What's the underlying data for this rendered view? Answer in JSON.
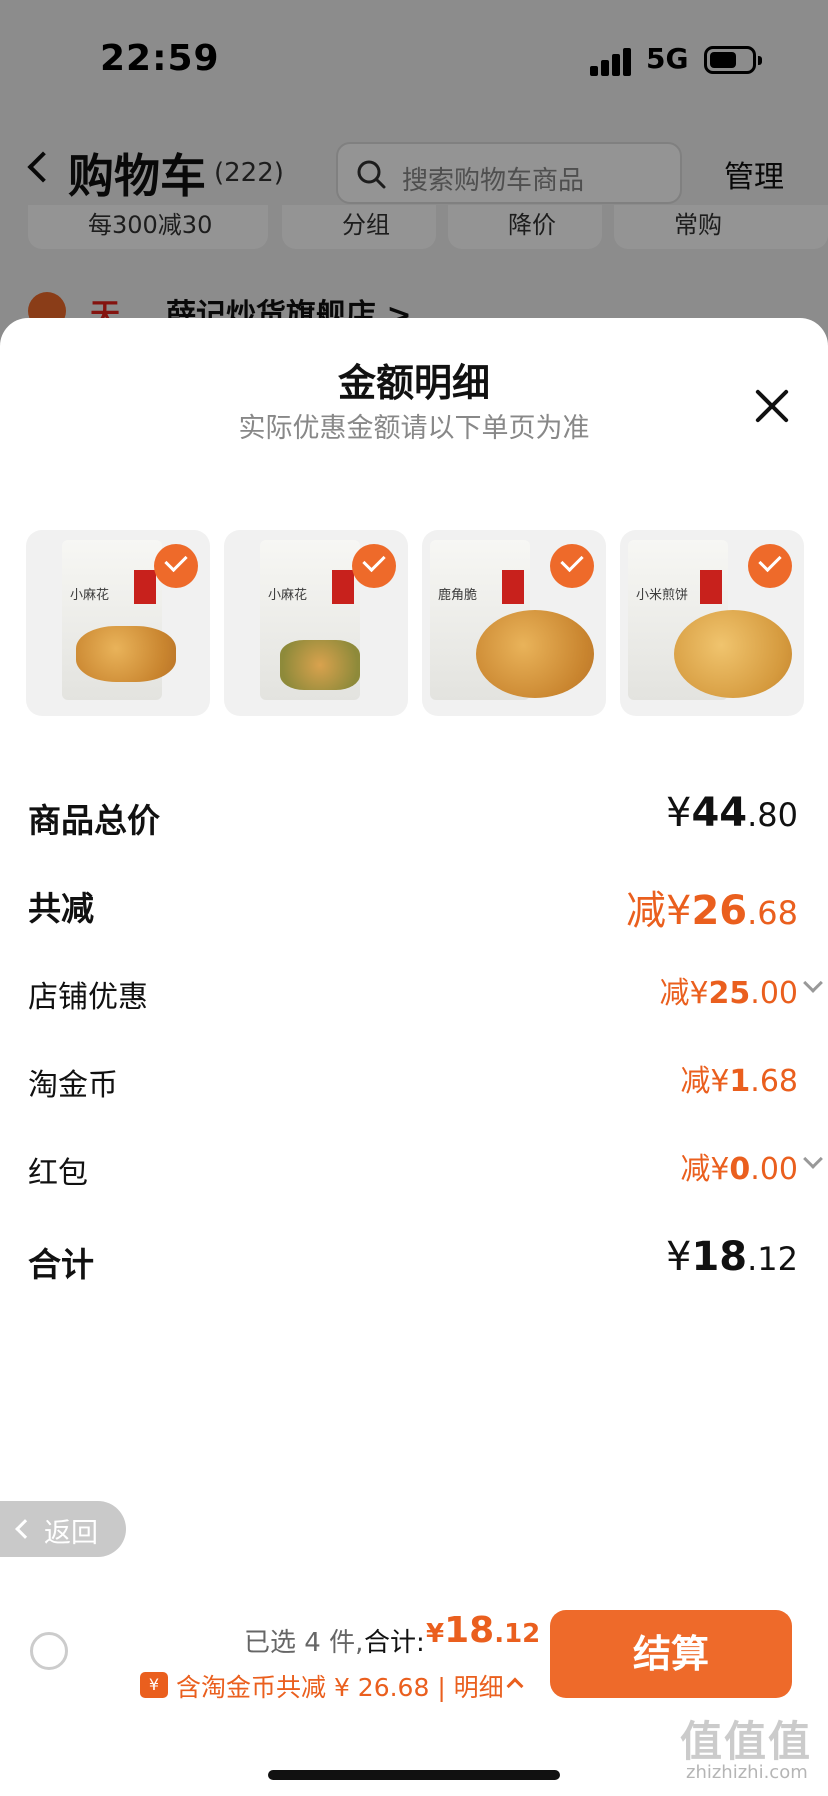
{
  "status": {
    "time": "22:59",
    "network": "5G"
  },
  "cart": {
    "title": "购物车",
    "count": "(222)",
    "search_placeholder": "搜索购物车商品",
    "manage": "管理",
    "filters": [
      "每300减30",
      "分组",
      "降价",
      "常购"
    ],
    "store_brand": "天猫",
    "store_name": "薛记炒货旗舰店 >"
  },
  "sheet": {
    "title": "金额明细",
    "subtitle": "实际优惠金额请以下单页为准",
    "products": [
      {
        "name": "小麻花",
        "icon": "product-thumbnail"
      },
      {
        "name": "小麻花",
        "icon": "product-thumbnail"
      },
      {
        "name": "鹿角脆",
        "icon": "product-thumbnail"
      },
      {
        "name": "小米煎饼",
        "icon": "product-thumbnail"
      }
    ],
    "rows": [
      {
        "label": "商品总价",
        "prefix": "",
        "sym": "¥",
        "int": "44",
        "dec": ".80"
      },
      {
        "label": "共减",
        "prefix": "减",
        "sym": "¥",
        "int": "26",
        "dec": ".68"
      },
      {
        "label": "店铺优惠",
        "prefix": "减",
        "sym": "¥",
        "int": "25",
        "dec": ".00"
      },
      {
        "label": "淘金币",
        "prefix": "减",
        "sym": "¥",
        "int": "1",
        "dec": ".68"
      },
      {
        "label": "红包",
        "prefix": "减",
        "sym": "¥",
        "int": "0",
        "dec": ".00"
      },
      {
        "label": "合计",
        "prefix": "",
        "sym": "¥",
        "int": "18",
        "dec": ".12"
      }
    ]
  },
  "back_pill": "返回",
  "bottom": {
    "selected": "已选 4 件,",
    "total_label": "合计:",
    "total_symbol": "¥",
    "total_int": "18",
    "total_dec": ".12",
    "coin_icon": "¥",
    "coin_text": "含淘金币共减 ¥ 26.68 | 明细",
    "checkout": "结算"
  },
  "watermark": {
    "main": "值值值",
    "sub": "zhizhizhi.com"
  },
  "colors": {
    "accent": "#ee6a2a",
    "price_orange": "#ea5f1e",
    "tmall_red": "#e3211b"
  }
}
